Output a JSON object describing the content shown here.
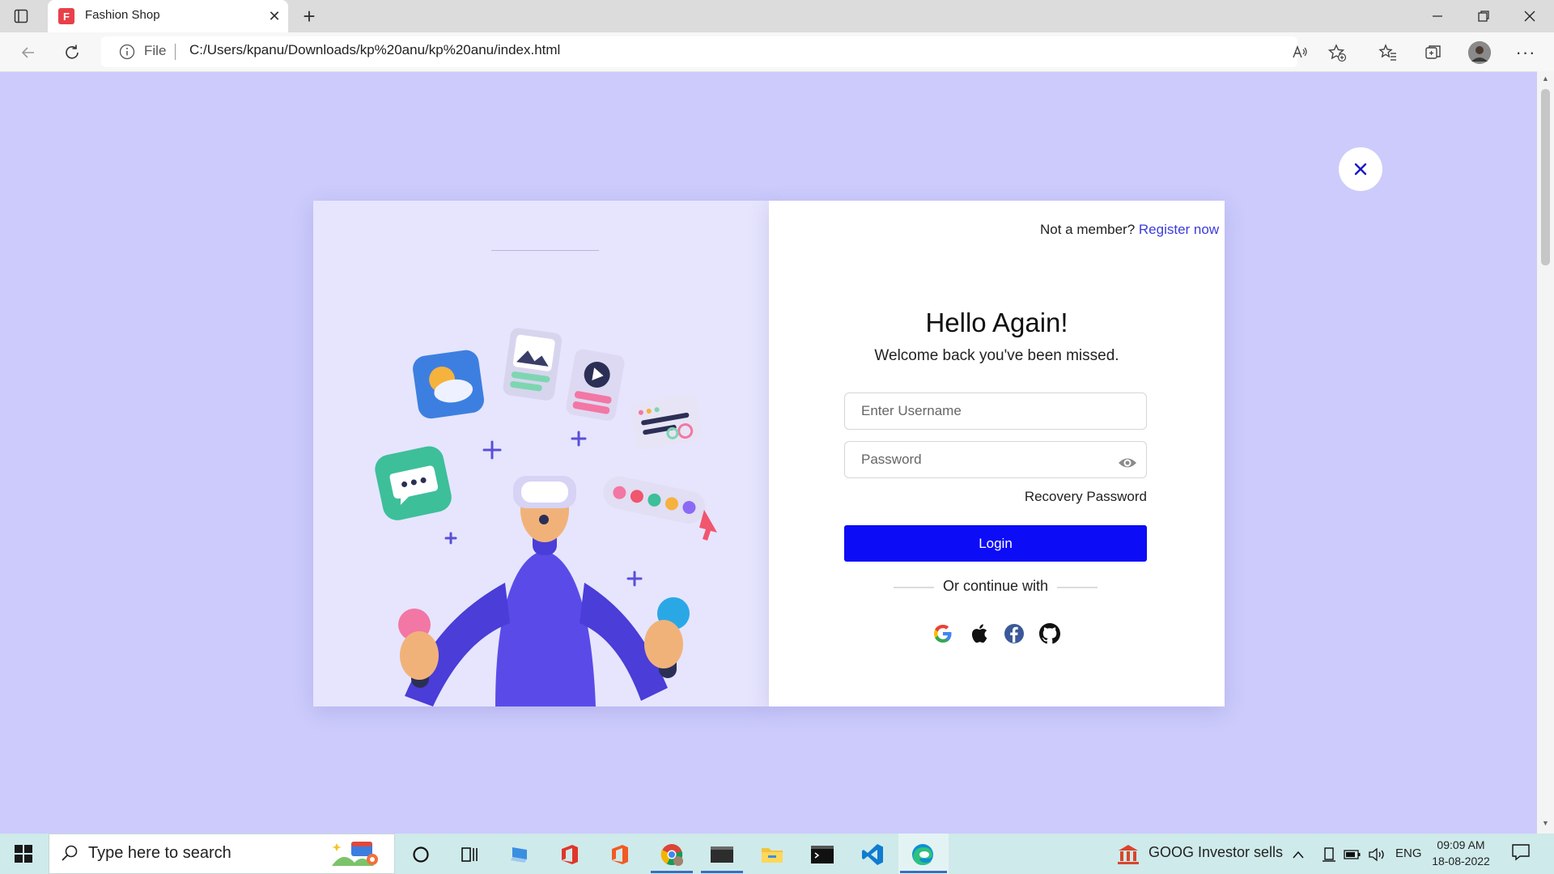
{
  "browser": {
    "tab_title": "Fashion Shop",
    "favicon_letter": "F",
    "address": {
      "scheme_label": "File",
      "url": "C:/Users/kpanu/Downloads/kp%20anu/kp%20anu/index.html"
    }
  },
  "login": {
    "not_member": "Not a member?",
    "register": "Register now",
    "title": "Hello Again!",
    "subtitle": "Welcome back you've been missed.",
    "username_placeholder": "Enter Username",
    "password_placeholder": "Password",
    "recovery": "Recovery Password",
    "login_label": "Login",
    "or_continue": "Or continue with",
    "social": [
      "google-icon",
      "apple-icon",
      "facebook-icon",
      "github-icon"
    ]
  },
  "taskbar": {
    "search_placeholder": "Type here to search",
    "news": "GOOG  Investor sells",
    "language": "ENG",
    "time": "09:09 AM",
    "date": "18-08-2022"
  },
  "colors": {
    "page_bg": "#cccbfb",
    "accent": "#0d0cf6",
    "link": "#3b3bdc",
    "illustration_bg": "#e6e5fd"
  }
}
